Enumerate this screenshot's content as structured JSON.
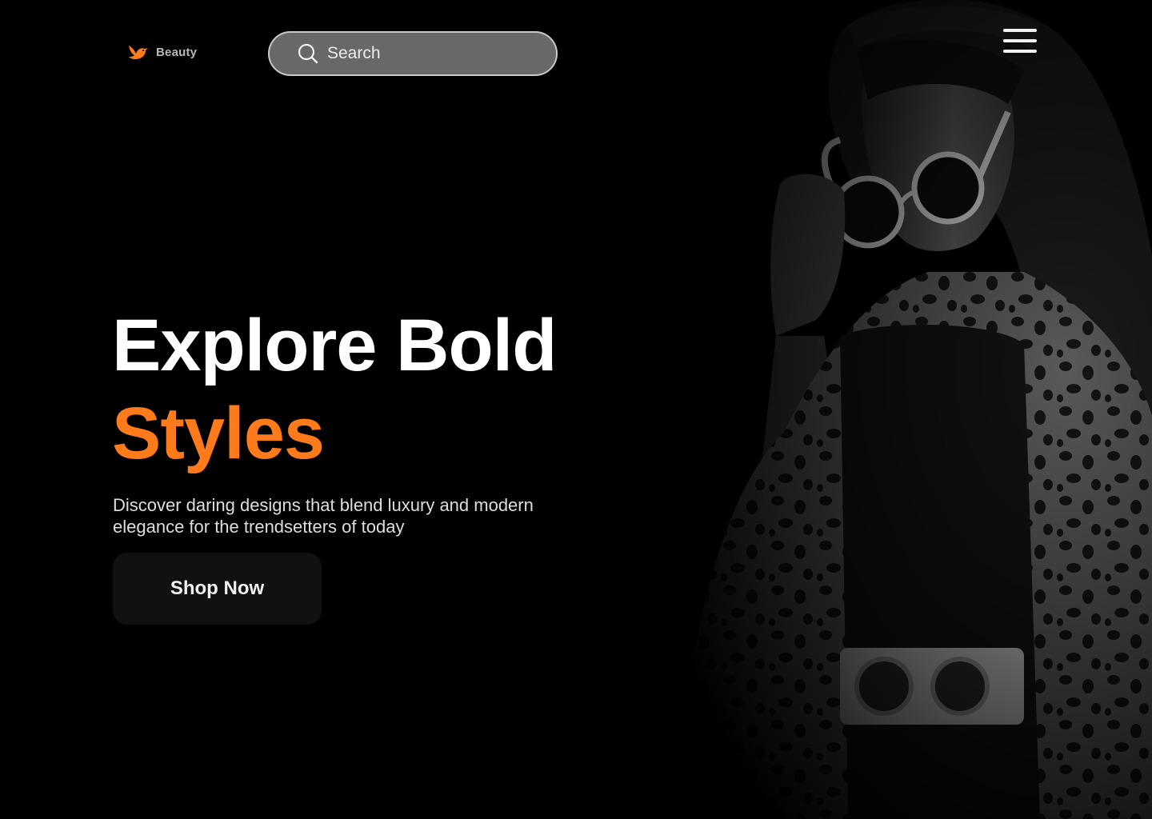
{
  "brand": {
    "name": "Beauty",
    "logo_icon": "bird-icon",
    "accent_color": "#ff7a1a"
  },
  "search": {
    "placeholder": "Search",
    "value": "",
    "icon": "search-icon"
  },
  "nav": {
    "menu_icon": "hamburger-menu-icon"
  },
  "hero": {
    "title_line1": "Explore Bold",
    "title_line2": "Styles",
    "description": "Discover daring designs that blend luxury and modern elegance for the trendsetters of today",
    "cta_label": "Shop Now",
    "title_color": "#ffffff",
    "title_highlight_color": "#ff7a1a",
    "background_color": "#000000"
  }
}
